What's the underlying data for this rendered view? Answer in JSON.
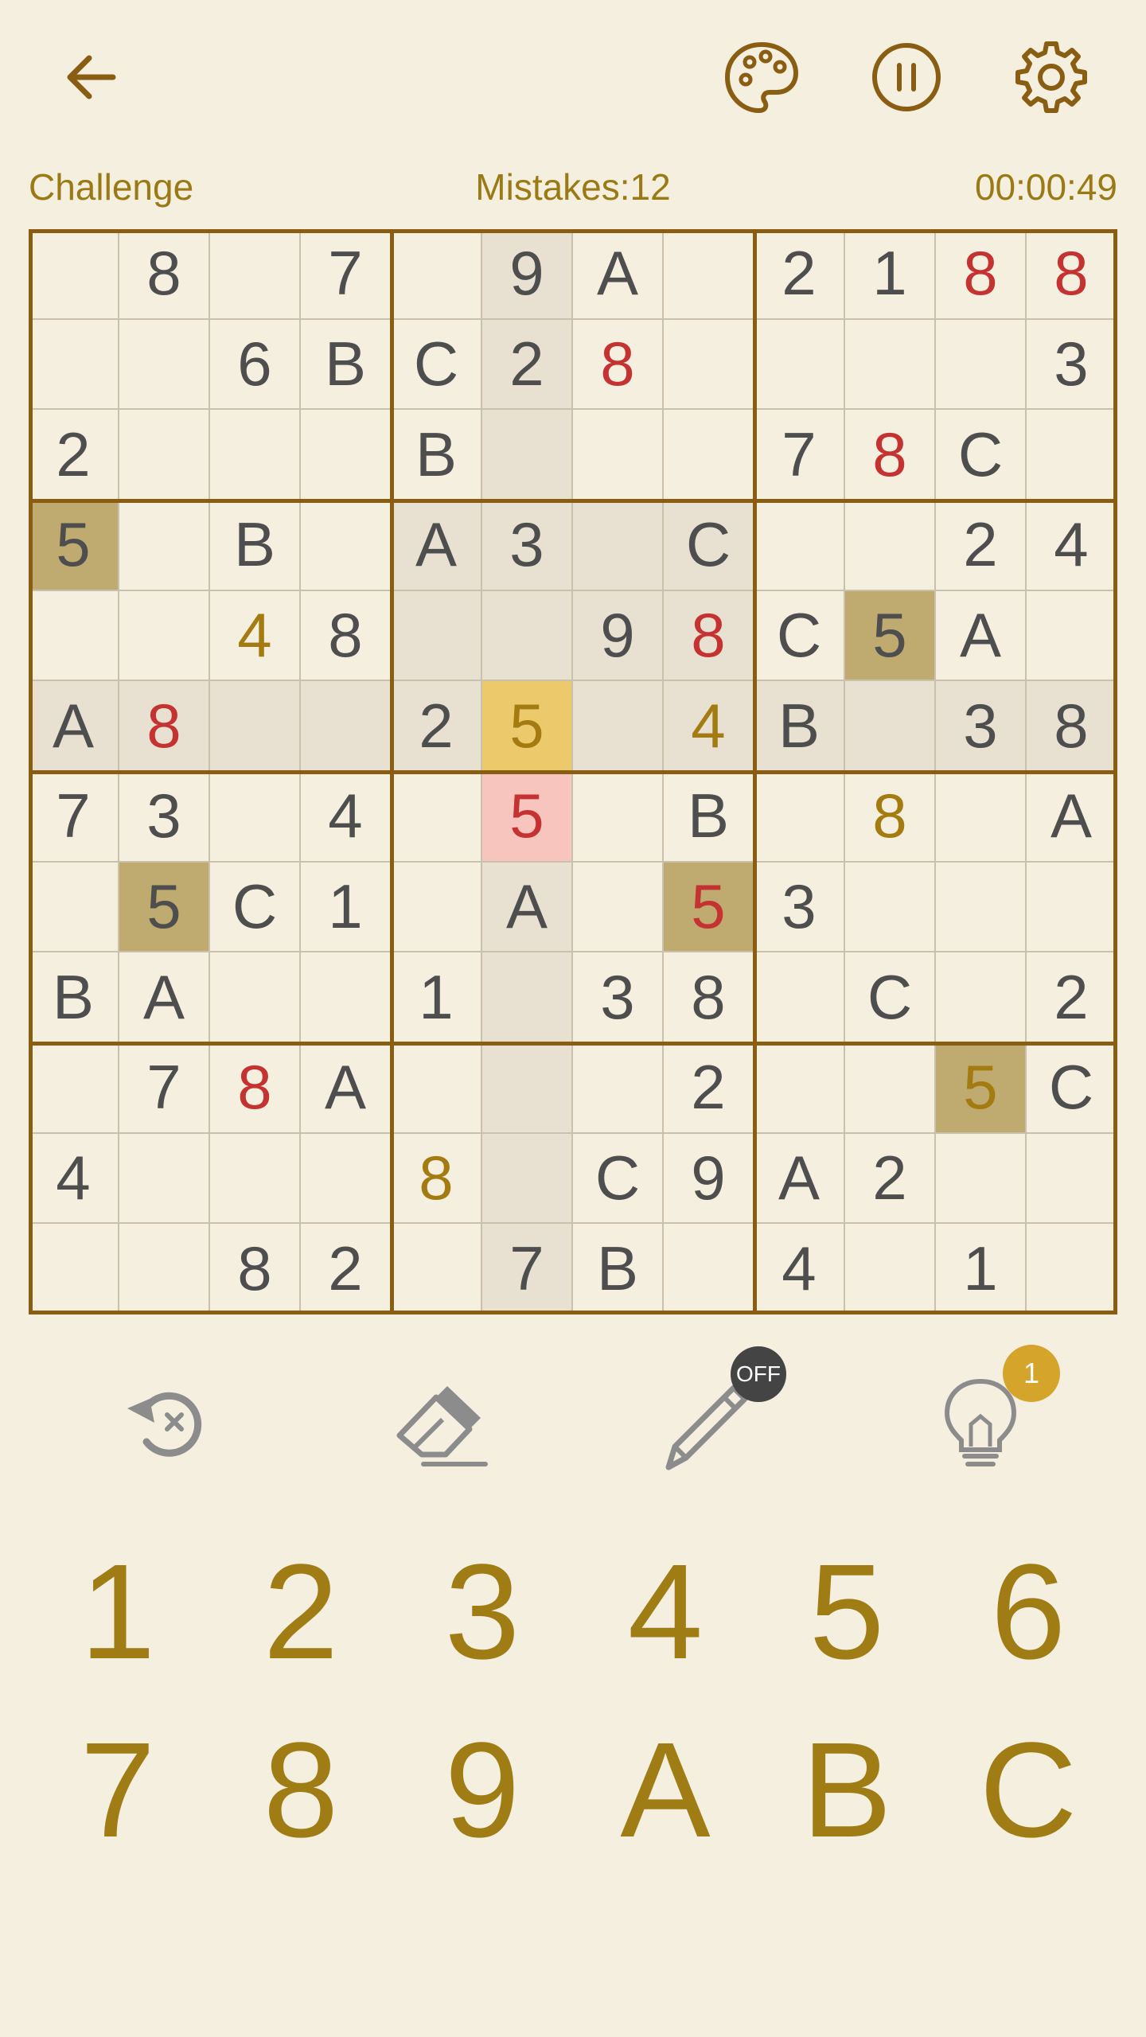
{
  "header": {
    "back_icon": "back-arrow-icon",
    "palette_icon": "palette-icon",
    "pause_icon": "pause-icon",
    "settings_icon": "gear-icon",
    "mode": "Challenge",
    "mistakes": "Mistakes:12",
    "timer": "00:00:49"
  },
  "board": {
    "rows": [
      [
        "",
        "8",
        "",
        "7",
        "",
        "9",
        "A",
        "",
        "2",
        "1",
        "8",
        "8"
      ],
      [
        "",
        "",
        "6",
        "B",
        "C",
        "2",
        "8",
        "",
        "",
        "",
        "",
        "3"
      ],
      [
        "2",
        "",
        "",
        "",
        "B",
        "",
        "",
        "",
        "7",
        "8",
        "C",
        ""
      ],
      [
        "5",
        "",
        "B",
        "",
        "A",
        "3",
        "",
        "C",
        "",
        "",
        "2",
        "4"
      ],
      [
        "",
        "",
        "4",
        "8",
        "",
        "",
        "9",
        "8",
        "C",
        "5",
        "A",
        ""
      ],
      [
        "A",
        "8",
        "",
        "",
        "2",
        "5",
        "",
        "4",
        "B",
        "",
        "3",
        "8"
      ],
      [
        "7",
        "3",
        "",
        "4",
        "",
        "5",
        "",
        "B",
        "",
        "8",
        "",
        "A"
      ],
      [
        "",
        "5",
        "C",
        "1",
        "",
        "A",
        "",
        "5",
        "3",
        "",
        "",
        ""
      ],
      [
        "B",
        "A",
        "",
        "",
        "1",
        "",
        "3",
        "8",
        "",
        "C",
        "",
        "2"
      ],
      [
        "",
        "7",
        "8",
        "A",
        "",
        "",
        "",
        "2",
        "",
        "",
        "5",
        "C"
      ],
      [
        "4",
        "",
        "",
        "",
        "8",
        "",
        "C",
        "9",
        "A",
        "2",
        "",
        ""
      ],
      [
        "",
        "",
        "8",
        "2",
        "",
        "7",
        "B",
        "",
        "4",
        "",
        "1",
        ""
      ]
    ],
    "selected": [
      5,
      5
    ],
    "error_cells": [
      [
        6,
        5
      ]
    ],
    "same_value_cells": [
      [
        3,
        0
      ],
      [
        4,
        9
      ],
      [
        7,
        1
      ],
      [
        7,
        7
      ],
      [
        9,
        10
      ]
    ],
    "red_digit_cells": [
      [
        0,
        10
      ],
      [
        0,
        11
      ],
      [
        1,
        6
      ],
      [
        2,
        9
      ],
      [
        4,
        7
      ],
      [
        5,
        1
      ],
      [
        6,
        5
      ],
      [
        7,
        7
      ],
      [
        9,
        2
      ]
    ],
    "gold_digit_cells": [
      [
        4,
        2
      ],
      [
        5,
        5
      ],
      [
        5,
        7
      ],
      [
        6,
        9
      ],
      [
        9,
        10
      ],
      [
        10,
        4
      ]
    ],
    "colors": {
      "background": "#f5efe0",
      "accent": "#a07d14",
      "error": "#c53232",
      "thick_border": "#8a5e12"
    }
  },
  "tools": {
    "undo_icon": "undo-icon",
    "erase_icon": "eraser-icon",
    "notes_icon": "pencil-icon",
    "notes_state": "OFF",
    "hint_icon": "lightbulb-icon",
    "hint_count": "1"
  },
  "numpad": [
    "1",
    "2",
    "3",
    "4",
    "5",
    "6",
    "7",
    "8",
    "9",
    "A",
    "B",
    "C"
  ]
}
